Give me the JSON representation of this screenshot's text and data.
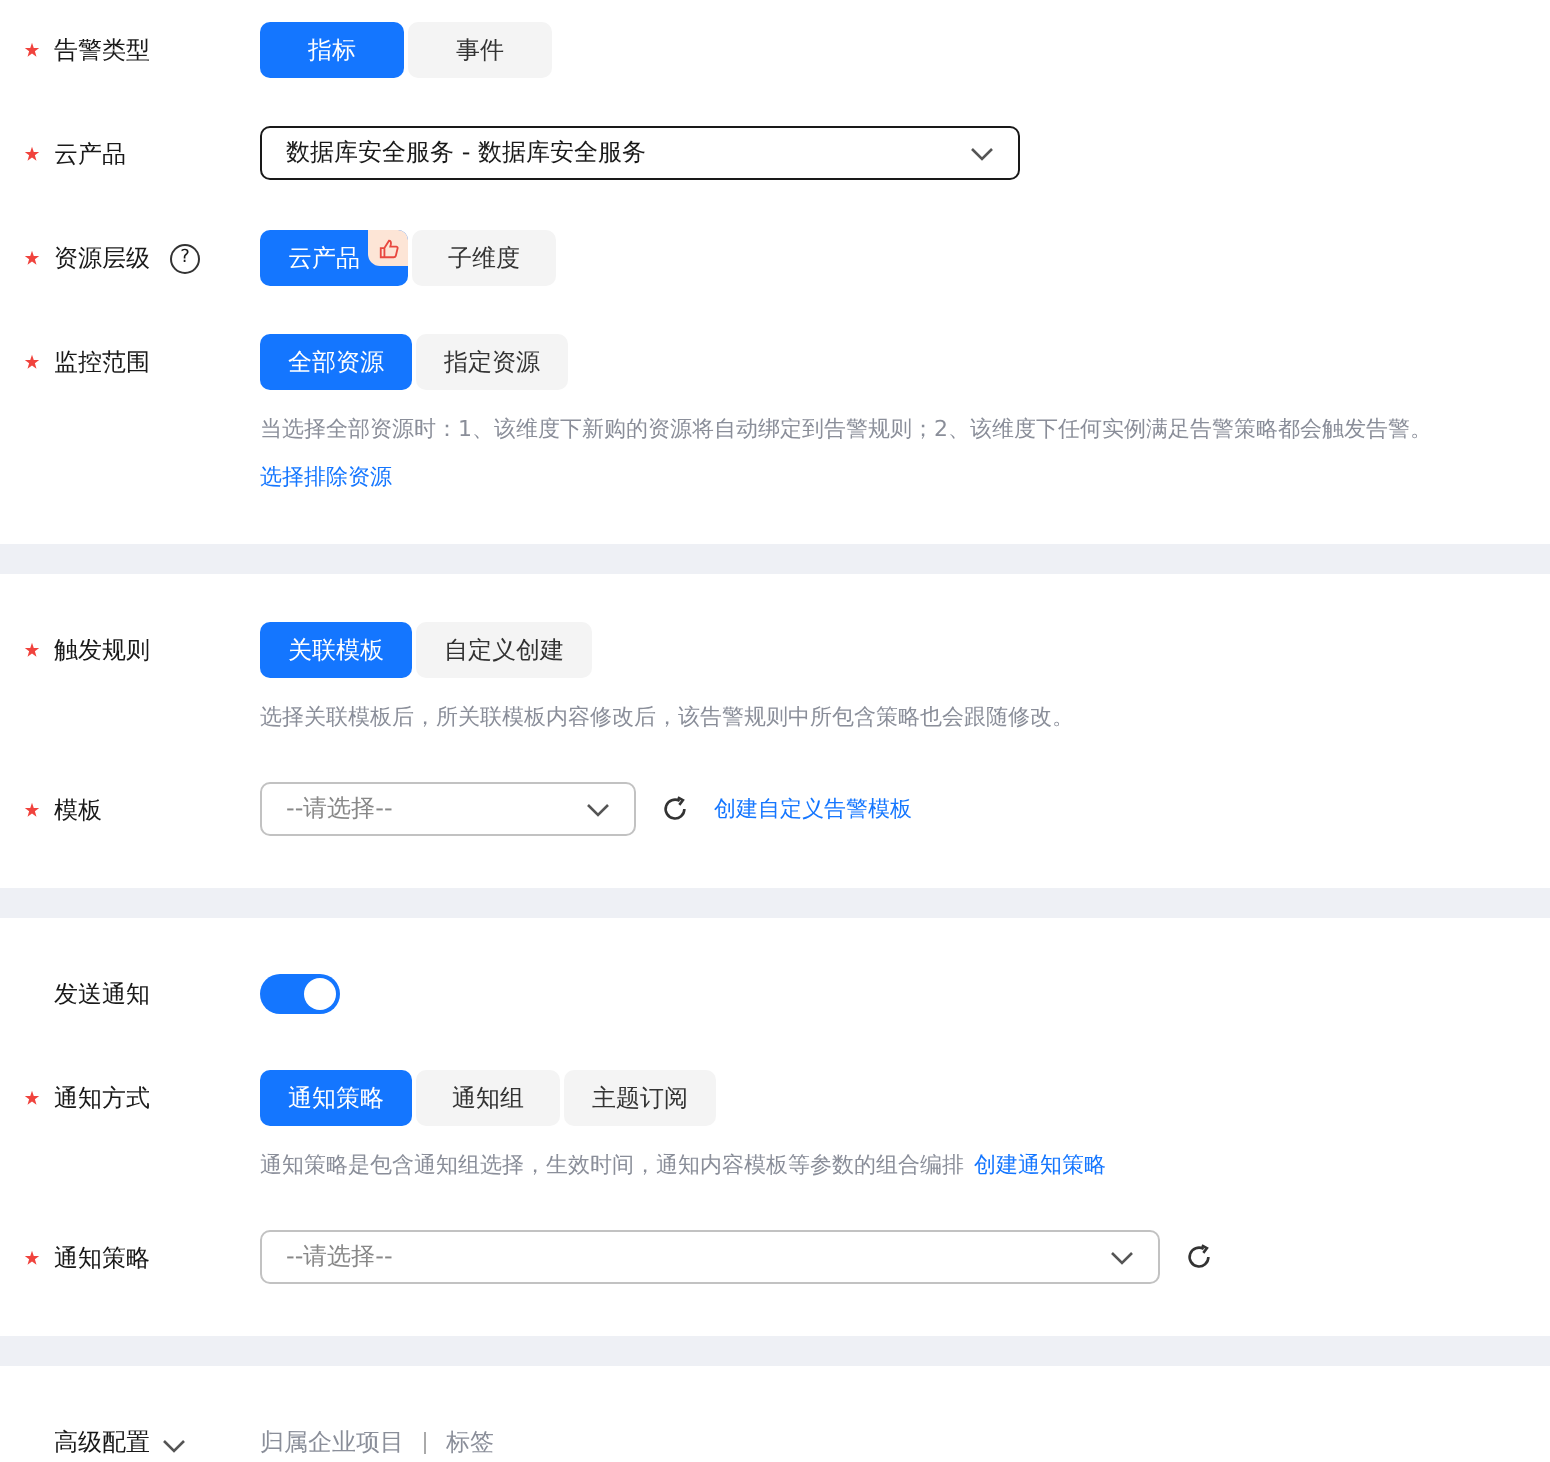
{
  "sections": [
    {
      "rows": [
        {
          "kind": "segmented",
          "label": "告警类型",
          "required": true,
          "options": [
            {
              "label": "指标",
              "selected": true
            },
            {
              "label": "事件",
              "selected": false
            }
          ]
        },
        {
          "kind": "select",
          "label": "云产品",
          "required": true,
          "value": "数据库安全服务 - 数据库安全服务"
        },
        {
          "kind": "segmented",
          "label": "资源层级",
          "required": true,
          "help": "?",
          "options": [
            {
              "label": "云产品",
              "selected": true,
              "recommended": true
            },
            {
              "label": "子维度",
              "selected": false
            }
          ]
        },
        {
          "kind": "segmented",
          "label": "监控范围",
          "required": true,
          "options": [
            {
              "label": "全部资源",
              "selected": true
            },
            {
              "label": "指定资源",
              "selected": false
            }
          ],
          "hint": "当选择全部资源时：1、该维度下新购的资源将自动绑定到告警规则；2、该维度下任何实例满足告警策略都会触发告警。",
          "link": "选择排除资源"
        }
      ]
    },
    {
      "rows": [
        {
          "kind": "segmented",
          "label": "触发规则",
          "required": true,
          "options": [
            {
              "label": "关联模板",
              "selected": true
            },
            {
              "label": "自定义创建",
              "selected": false
            }
          ],
          "hint": "选择关联模板后，所关联模板内容修改后，该告警规则中所包含策略也会跟随修改。"
        },
        {
          "kind": "select",
          "label": "模板",
          "required": true,
          "placeholder": "--请选择--",
          "refresh": true,
          "action_link": "创建自定义告警模板"
        }
      ]
    },
    {
      "rows": [
        {
          "kind": "toggle",
          "label": "发送通知",
          "required": false,
          "on": true
        },
        {
          "kind": "segmented",
          "label": "通知方式",
          "required": true,
          "options": [
            {
              "label": "通知策略",
              "selected": true
            },
            {
              "label": "通知组",
              "selected": false
            },
            {
              "label": "主题订阅",
              "selected": false
            }
          ],
          "hint": "通知策略是包含通知组选择，生效时间，通知内容模板等参数的组合编排",
          "hint_link": "创建通知策略"
        },
        {
          "kind": "select",
          "label": "通知策略",
          "required": true,
          "placeholder": "--请选择--",
          "refresh": true
        }
      ]
    }
  ],
  "advanced": {
    "label": "高级配置",
    "expanded": false,
    "items": [
      "归属企业项目",
      "标签"
    ]
  }
}
